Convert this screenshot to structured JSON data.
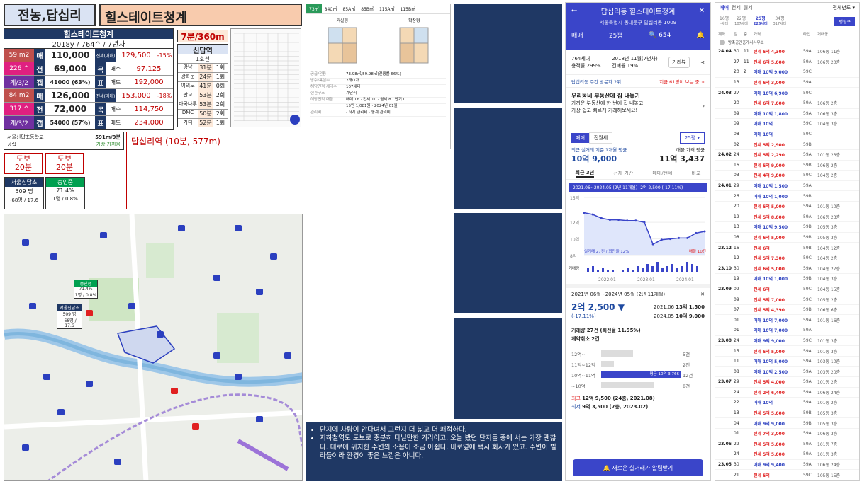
{
  "header": {
    "area": "전농,답십리",
    "complex": "힐스테이트청계"
  },
  "summary": {
    "name": "힐스테이트청계",
    "info": "2018y / 764^ / 7년차",
    "rows": [
      {
        "size": "59 m2",
        "t1": "매",
        "v1": "110,000",
        "lbl": "전세(매매)",
        "v2": "129,500",
        "pct": "-15%"
      },
      {
        "size": "226 ^",
        "t1": "전",
        "v1": "69,000",
        "lbl": "목",
        "lbl2": "매수",
        "v2": "97,125"
      },
      {
        "size": "계/3/2",
        "t1": "갭",
        "v1": "41000 (63%)",
        "lbl": "표",
        "lbl2": "매도",
        "v2": "192,000"
      },
      {
        "size": "84 m2",
        "t1": "매",
        "v1": "126,000",
        "lbl": "전세(매매)",
        "v2": "153,000",
        "pct": "-18%"
      },
      {
        "size": "317 ^",
        "t1": "전",
        "v1": "72,000",
        "lbl": "목",
        "lbl2": "매수",
        "v2": "114,750"
      },
      {
        "size": "계/3/2",
        "t1": "갭",
        "v1": "54000 (57%)",
        "lbl": "표",
        "lbl2": "매도",
        "v2": "234,000"
      }
    ]
  },
  "station": {
    "distance": "7분/360m",
    "title": "신답역",
    "line": "1호선",
    "stops": [
      {
        "name": "강남",
        "min": "31분",
        "tr": "1회"
      },
      {
        "name": "광화문",
        "min": "24분",
        "tr": "1회"
      },
      {
        "name": "여의도",
        "min": "41분",
        "tr": "0회"
      },
      {
        "name": "판교",
        "min": "53분",
        "tr": "2회"
      },
      {
        "name": "마곡나루",
        "min": "53분",
        "tr": "2회"
      },
      {
        "name": "DMC",
        "min": "50분",
        "tr": "2회"
      },
      {
        "name": "가디",
        "min": "52분",
        "tr": "1회"
      }
    ]
  },
  "school": {
    "name": "서울신답초등학교",
    "dist": "591m/9분",
    "type": "공립",
    "link": "가장 가까움"
  },
  "subway": {
    "text": "답십리역 (10분, 577m)"
  },
  "walk": [
    {
      "label": "도보",
      "val": "20분"
    },
    {
      "label": "도보",
      "val": "20분"
    }
  ],
  "schools2": [
    {
      "name": "서울신답초",
      "students": "509 명",
      "ratio": "-68명 / 17.6"
    },
    {
      "name": "숭인중",
      "students": "71.4%",
      "ratio": "1명 / 0.8%"
    }
  ],
  "map": {
    "label1": {
      "name": "숭인중",
      "v1": "71.4%",
      "v2": "1명 / 0.8%"
    },
    "label2": {
      "name": "서울신답초",
      "v1": "509 명",
      "v2": "-68명 / 17.6"
    }
  },
  "floorplan": {
    "tabs": [
      "73㎡",
      "84C㎡",
      "85A㎡",
      "85B㎡",
      "115A㎡",
      "115B㎡"
    ],
    "plans": [
      "거실형",
      "확장형"
    ],
    "rows": [
      {
        "k": "공급/전용",
        "v": "73.98㎡/59.98㎡(전용률 66%)"
      },
      {
        "k": "방수/욕실수",
        "v": "2개/1개"
      },
      {
        "k": "해당면적 세대수",
        "v": "107세대"
      },
      {
        "k": "현관구조",
        "v": "계단식"
      },
      {
        "k": "해당면적 매물",
        "v": "매매 16 · 전세 10 · 월세 8 · 단기 0"
      },
      {
        "k": "",
        "v": "15만 1,081원 · 2024년 01월"
      },
      {
        "k": "관리비",
        "v": "· 하계 관리비 · 동계 관리비"
      }
    ]
  },
  "notes": [
    "단지에 차량이 안다녀서 그런지 더 넓고 더 쾌적하다.",
    "지하철역도 도보로 충분히 다닐만한 거리이고. 오늘 봤던 단지들 중에 서는 가장 괜찮다. 대로에 위치한 주변의 소음이 조금 아쉽다. 바로옆에 택시 회사가 있고. 주변이 빌라들이라 환경이 좋은 느낌은 아니다."
  ],
  "phone": {
    "title": "답십리동 힐스테이트청계",
    "address": "서울특별시 동대문구 답십리동 1009",
    "tab": "매매",
    "size": "25평",
    "views": "654",
    "stats1": "764세대",
    "stats2": "용적률 299%",
    "stats3": "2018년 11월(7년차)",
    "stats4": "건폐율 19%",
    "btn": "거리뷰",
    "rank": "답십리동 주간 방문자 2위",
    "rank2": "지금 61명이 보는 중 >",
    "promo1": "우리동네 부동산에 집 내놓기",
    "promo2": "가까운 부동산에 한 번에 집 내놓고",
    "promo3": "가장 쉽고 빠르게 거래해보세요!",
    "tabs2": [
      "매매",
      "전월세"
    ],
    "size2": "25평",
    "avgLabel": "최근 실거래 기준 1개월 평균",
    "avgVal": "10억 9,000",
    "askLabel": "매물 가격 평균",
    "askVal": "11억 3,437",
    "ptabs": [
      "최근 3년",
      "전체 기간",
      "매매/전세",
      "비교"
    ],
    "chartHeader": "2021.06~2024.05 (2년 11개월) -2억 2,500 (-17.11%)",
    "years": [
      "2022.01",
      "2023.01",
      "2024.01"
    ],
    "yticks": [
      "15억",
      "12억",
      "10억",
      "8억"
    ],
    "volLabel": "거래량",
    "legend": "실거래 27건 / 회전율 12%",
    "legend2": "매물 10건",
    "range": "2021년 06월~2024년 05월 (2년 11개월)",
    "change": "2억 2,500 ▼",
    "changePct": "(-17.11%)",
    "from": "2021.06",
    "fromVal": "13억 1,500",
    "to": "2024.05",
    "toVal": "10억 9,000",
    "tradeLabel": "거래량 27건 (회전율 11.95%)",
    "cancel": "계약취소 2건",
    "bars": [
      {
        "label": "12억~",
        "cnt": "5건",
        "frac": 0.4
      },
      {
        "label": "11억~12억",
        "cnt": "2건",
        "frac": 0.16
      },
      {
        "label": "10억~11억",
        "cnt": "12건",
        "frac": 1,
        "note": "평균 10억 3,766"
      },
      {
        "label": "~10억",
        "cnt": "8건",
        "frac": 0.66
      }
    ],
    "maxLabel": "최고",
    "maxVal": "12억 9,500 (24층, 2021.08)",
    "minLabel": "최저",
    "minVal": "9억 3,500 (7층, 2023.02)",
    "cta": "새로운 실거래가 알림받기"
  },
  "trades": {
    "tabs": [
      "매매",
      "전세",
      "월세"
    ],
    "period": "전체년도",
    "sizes": [
      "16평",
      "22평",
      "25평",
      "34평"
    ],
    "sizesSub": [
      "-세대",
      "107세대",
      "226세대",
      "317세대"
    ],
    "btn": "평형구",
    "cols": [
      "계약",
      "일",
      "층",
      "가격",
      "타입",
      "거래동"
    ],
    "agent": "방축공인중개사사무소",
    "rows": [
      {
        "ym": "24.04",
        "d": "30",
        "f": "11",
        "p": "전세 5억 4,300",
        "t": "59A",
        "b": "106동 11층",
        "k": "j"
      },
      {
        "ym": "",
        "d": "27",
        "f": "11",
        "p": "전세 6억 5,000",
        "t": "59A",
        "b": "106동 20층",
        "k": "j"
      },
      {
        "ym": "",
        "d": "20",
        "f": "2",
        "p": "매매 10억 9,000",
        "t": "59C",
        "b": "",
        "k": "m"
      },
      {
        "ym": "",
        "d": "13",
        "f": "",
        "p": "전세 6억 3,000",
        "t": "59A",
        "b": "",
        "k": "j"
      },
      {
        "ym": "24.03",
        "d": "27",
        "f": "",
        "p": "매매 10억 6,900",
        "t": "59C",
        "b": "",
        "k": "m"
      },
      {
        "ym": "",
        "d": "20",
        "f": "",
        "p": "전세 6억 7,000",
        "t": "59A",
        "b": "106동 2층",
        "k": "j"
      },
      {
        "ym": "",
        "d": "09",
        "f": "",
        "p": "매매 10억 1,800",
        "t": "59A",
        "b": "106동 3층",
        "k": "m"
      },
      {
        "ym": "",
        "d": "09",
        "f": "",
        "p": "매매 10억",
        "t": "59C",
        "b": "104동 3층",
        "k": "m"
      },
      {
        "ym": "",
        "d": "08",
        "f": "",
        "p": "매매 10억",
        "t": "59C",
        "b": "",
        "k": "m"
      },
      {
        "ym": "",
        "d": "02",
        "f": "",
        "p": "전세 5억 2,900",
        "t": "59B",
        "b": "",
        "k": "j"
      },
      {
        "ym": "24.02",
        "d": "24",
        "f": "",
        "p": "전세 5억 2,290",
        "t": "59A",
        "b": "101동 23층",
        "k": "j"
      },
      {
        "ym": "",
        "d": "16",
        "f": "",
        "p": "전세 5억 9,000",
        "t": "59B",
        "b": "106동 2층",
        "k": "j"
      },
      {
        "ym": "",
        "d": "03",
        "f": "",
        "p": "전세 4억 9,800",
        "t": "59C",
        "b": "104동 2층",
        "k": "j"
      },
      {
        "ym": "24.01",
        "d": "29",
        "f": "",
        "p": "매매 10억 1,500",
        "t": "59A",
        "b": "",
        "k": "m"
      },
      {
        "ym": "",
        "d": "26",
        "f": "",
        "p": "매매 10억 1,000",
        "t": "59B",
        "b": "",
        "k": "m"
      },
      {
        "ym": "",
        "d": "20",
        "f": "",
        "p": "전세 5억 5,000",
        "t": "59A",
        "b": "101동 10층",
        "k": "j"
      },
      {
        "ym": "",
        "d": "19",
        "f": "",
        "p": "전세 5억 8,000",
        "t": "59A",
        "b": "106동 23층",
        "k": "j"
      },
      {
        "ym": "",
        "d": "13",
        "f": "",
        "p": "매매 10억 9,500",
        "t": "59B",
        "b": "105동 3층",
        "k": "m"
      },
      {
        "ym": "",
        "d": "08",
        "f": "",
        "p": "전세 6억 5,000",
        "t": "59B",
        "b": "105동 3층",
        "k": "j"
      },
      {
        "ym": "23.12",
        "d": "16",
        "f": "",
        "p": "전세 6억",
        "t": "59B",
        "b": "104동 12층",
        "k": "j"
      },
      {
        "ym": "",
        "d": "12",
        "f": "",
        "p": "전세 5억 7,300",
        "t": "59C",
        "b": "104동 2층",
        "k": "j"
      },
      {
        "ym": "23.10",
        "d": "30",
        "f": "",
        "p": "전세 6억 5,000",
        "t": "59A",
        "b": "104동 27층",
        "k": "j"
      },
      {
        "ym": "",
        "d": "19",
        "f": "",
        "p": "매매 10억 1,000",
        "t": "59B",
        "b": "104동 3층",
        "k": "m"
      },
      {
        "ym": "23.09",
        "d": "09",
        "f": "",
        "p": "전세 6억",
        "t": "59C",
        "b": "104동 15층",
        "k": "j"
      },
      {
        "ym": "",
        "d": "09",
        "f": "",
        "p": "전세 5억 7,000",
        "t": "59C",
        "b": "105동 2층",
        "k": "j"
      },
      {
        "ym": "",
        "d": "07",
        "f": "",
        "p": "전세 5억 4,390",
        "t": "59B",
        "b": "106동 6층",
        "k": "j"
      },
      {
        "ym": "",
        "d": "01",
        "f": "",
        "p": "매매 10억 7,000",
        "t": "59A",
        "b": "101동 16층",
        "k": "m"
      },
      {
        "ym": "",
        "d": "01",
        "f": "",
        "p": "매매 10억 7,000",
        "t": "59A",
        "b": "",
        "k": "m"
      },
      {
        "ym": "23.08",
        "d": "24",
        "f": "",
        "p": "매매 9억 9,000",
        "t": "59C",
        "b": "101동 3층",
        "k": "m"
      },
      {
        "ym": "",
        "d": "15",
        "f": "",
        "p": "전세 5억 5,000",
        "t": "59A",
        "b": "101동 3층",
        "k": "j"
      },
      {
        "ym": "",
        "d": "11",
        "f": "",
        "p": "매매 10억 5,000",
        "t": "59A",
        "b": "103동 10층",
        "k": "m"
      },
      {
        "ym": "",
        "d": "08",
        "f": "",
        "p": "매매 10억 2,500",
        "t": "59A",
        "b": "103동 20층",
        "k": "m"
      },
      {
        "ym": "23.07",
        "d": "29",
        "f": "",
        "p": "전세 5억 4,000",
        "t": "59A",
        "b": "101동 2층",
        "k": "j"
      },
      {
        "ym": "",
        "d": "24",
        "f": "",
        "p": "전세 2억 6,400",
        "t": "59A",
        "b": "106동 24층",
        "k": "j"
      },
      {
        "ym": "",
        "d": "22",
        "f": "",
        "p": "매매 10억",
        "t": "59A",
        "b": "101동 2층",
        "k": "m"
      },
      {
        "ym": "",
        "d": "13",
        "f": "",
        "p": "전세 5억 5,000",
        "t": "59B",
        "b": "105동 3층",
        "k": "j"
      },
      {
        "ym": "",
        "d": "04",
        "f": "",
        "p": "매매 9억 9,000",
        "t": "59B",
        "b": "105동 3층",
        "k": "m"
      },
      {
        "ym": "",
        "d": "01",
        "f": "",
        "p": "전세 7억 3,000",
        "t": "59A",
        "b": "106동 3층",
        "k": "j"
      },
      {
        "ym": "23.06",
        "d": "29",
        "f": "",
        "p": "전세 5억 5,000",
        "t": "59A",
        "b": "101동 7층",
        "k": "j"
      },
      {
        "ym": "",
        "d": "24",
        "f": "",
        "p": "전세 5억 5,000",
        "t": "59A",
        "b": "101동 3층",
        "k": "j"
      },
      {
        "ym": "23.05",
        "d": "30",
        "f": "",
        "p": "매매 9억 9,400",
        "t": "59A",
        "b": "106동 24층",
        "k": "m"
      },
      {
        "ym": "",
        "d": "21",
        "f": "",
        "p": "전세 5억",
        "t": "59C",
        "b": "105동 15층",
        "k": "j"
      }
    ]
  },
  "chart_data": {
    "type": "line",
    "x": [
      "2021.06",
      "2021.08",
      "2021.10",
      "2022.01",
      "2022.04",
      "2022.07",
      "2022.10",
      "2023.01",
      "2023.02",
      "2023.04",
      "2023.07",
      "2023.10",
      "2024.01",
      "2024.03",
      "2024.05"
    ],
    "series": [
      {
        "name": "실거래",
        "values": [
          13.15,
          12.95,
          12.5,
          12.3,
          12.3,
          12.2,
          12.2,
          12.0,
          9.35,
          9.9,
          10.0,
          10.1,
          10.1,
          10.7,
          10.9
        ]
      }
    ],
    "ylim": [
      8,
      15
    ],
    "xlabel": "",
    "ylabel": "",
    "title": ""
  },
  "colors": {
    "navy": "#1f3864",
    "red": "#c0504d",
    "purple": "#7030a0",
    "magenta": "#e02080",
    "accent": "#2b3fbf"
  }
}
